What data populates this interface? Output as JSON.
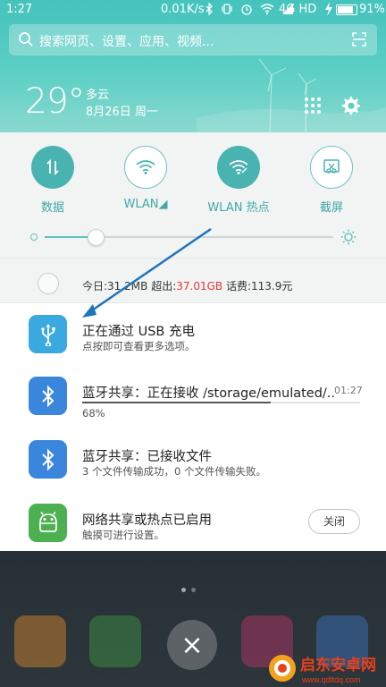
{
  "status_bar": {
    "time": "1:27",
    "speed": "0.01K/s",
    "network": "4G HD",
    "battery": "91%",
    "battery_level": 0.91
  },
  "search": {
    "placeholder": "搜索网页、设置、应用、视频..."
  },
  "weather": {
    "temperature": "29°",
    "condition": "多云",
    "date": "8月26日 周一"
  },
  "toggles": [
    {
      "label": "数据",
      "icon": "mobile-data-icon",
      "active": true
    },
    {
      "label": "WLAN",
      "icon": "wifi-icon",
      "active": false
    },
    {
      "label": "WLAN 热点",
      "icon": "hotspot-icon",
      "active": true
    },
    {
      "label": "截屏",
      "icon": "screenshot-icon",
      "active": false
    }
  ],
  "brightness": {
    "level": 0.18
  },
  "data_usage": {
    "today": "今日:31.2MB",
    "over_label": "超出:",
    "over_value": "37.01GB",
    "balance": "话费:113.9元"
  },
  "notifications": [
    {
      "title": "正在通过 USB 充电",
      "subtitle": "点按即可查看更多选项。",
      "icon": "usb-icon"
    },
    {
      "title": "蓝牙共享：正在接收 /storage/emulated/..",
      "time": "01:27",
      "progress": "68%",
      "progress_value": 0.68,
      "icon": "bluetooth-icon"
    },
    {
      "title": "蓝牙共享：已接收文件",
      "subtitle": "3 个文件传输成功，0 个文件传输失败。",
      "icon": "bluetooth-icon"
    },
    {
      "title": "网络共享或热点已启用",
      "subtitle": "触摸可进行设置。",
      "button": "关闭",
      "icon": "android-icon"
    }
  ],
  "colors": {
    "accent": "#49b3b1",
    "header": "#5ccfc5",
    "usb_icon_bg": "#3aa9e0",
    "bluetooth_icon_bg": "#3a86dc",
    "android_icon_bg": "#4cb050",
    "warning_text": "#e23a3a",
    "arrow": "#1f73b8"
  },
  "watermark": {
    "text": "启东安卓网",
    "url": "www.qdltdq.com"
  }
}
